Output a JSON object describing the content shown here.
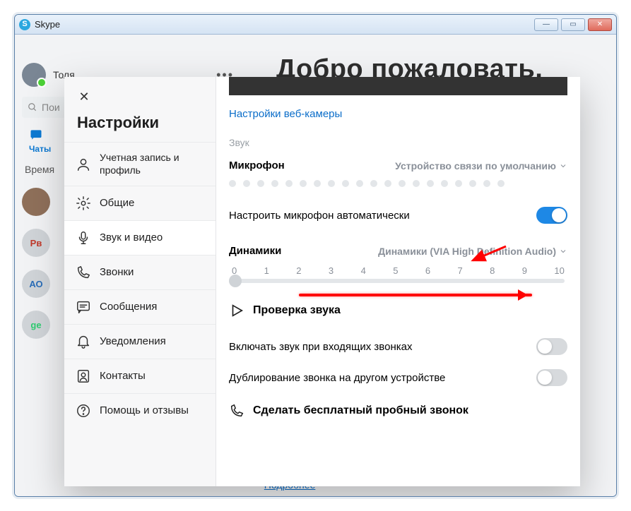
{
  "window": {
    "title": "Skype"
  },
  "app": {
    "welcome": "Добро пожаловать,",
    "user_name": "Толя",
    "search_placeholder": "Пои",
    "tab_chats": "Чаты",
    "time_header": "Время",
    "contacts": [
      {
        "initials": "",
        "type": "photo"
      },
      {
        "initials": "Рв",
        "type": "pb"
      },
      {
        "initials": "АО",
        "type": "ao"
      },
      {
        "initials": "ge",
        "type": "ge"
      }
    ],
    "more_link": "Подробнее"
  },
  "settings": {
    "title": "Настройки",
    "nav": {
      "account": "Учетная запись и профиль",
      "general": "Общие",
      "audio_video": "Звук и видео",
      "calling": "Звонки",
      "messaging": "Сообщения",
      "notifications": "Уведомления",
      "contacts": "Контакты",
      "help": "Помощь и отзывы"
    },
    "panel": {
      "webcam_link": "Настройки веб-камеры",
      "sound_section": "Звук",
      "microphone_label": "Микрофон",
      "microphone_device": "Устройство связи по умолчанию",
      "mic_auto_adjust": "Настроить микрофон автоматически",
      "mic_auto_adjust_on": true,
      "speakers_label": "Динамики",
      "speakers_device": "Динамики (VIA High Definition Audio)",
      "volume_ticks": [
        "0",
        "1",
        "2",
        "3",
        "4",
        "5",
        "6",
        "7",
        "8",
        "9",
        "10"
      ],
      "speaker_value": 0,
      "test_audio": "Проверка звука",
      "ring_incoming": "Включать звук при входящих звонках",
      "ring_incoming_on": false,
      "ring_dup": "Дублирование звонка на другом устройстве",
      "ring_dup_on": false,
      "free_test_call": "Сделать бесплатный пробный звонок"
    }
  }
}
